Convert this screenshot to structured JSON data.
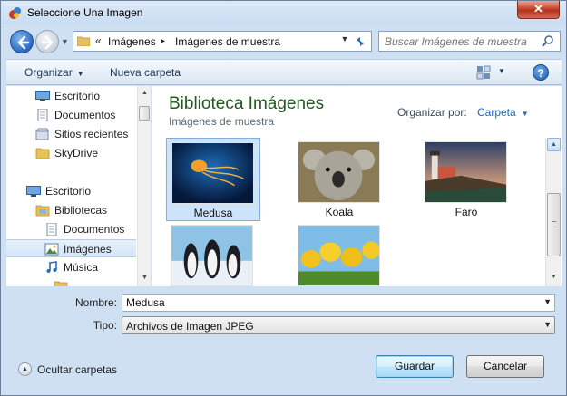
{
  "window": {
    "title": "Seleccione Una Imagen",
    "close_label": "✕"
  },
  "address": {
    "breadcrumb_prefix": "«",
    "crumbs": [
      "Imágenes",
      "Imágenes de muestra"
    ],
    "separator": "▸"
  },
  "search": {
    "placeholder": "Buscar Imágenes de muestra"
  },
  "toolbar": {
    "organize_label": "Organizar",
    "new_folder_label": "Nueva carpeta",
    "help_label": "?"
  },
  "navpane": {
    "items": [
      {
        "label": "Escritorio",
        "icon": "desktop-icon"
      },
      {
        "label": "Documentos",
        "icon": "documents-icon"
      },
      {
        "label": "Sitios recientes",
        "icon": "recent-places-icon"
      },
      {
        "label": "SkyDrive",
        "icon": "folder-icon"
      },
      {
        "label": "Escritorio",
        "icon": "desktop-icon"
      },
      {
        "label": "Bibliotecas",
        "icon": "libraries-icon"
      },
      {
        "label": "Documentos",
        "icon": "documents-icon"
      },
      {
        "label": "Imágenes",
        "icon": "pictures-icon",
        "selected": true
      },
      {
        "label": "Música",
        "icon": "music-icon"
      }
    ]
  },
  "content": {
    "library_title": "Biblioteca Imágenes",
    "library_subtitle": "Imágenes de muestra",
    "arrange_label": "Organizar por:",
    "arrange_value": "Carpeta",
    "thumbnails": [
      {
        "label": "Medusa",
        "subject": "jellyfish",
        "selected": true
      },
      {
        "label": "Koala",
        "subject": "koala"
      },
      {
        "label": "Faro",
        "subject": "lighthouse"
      },
      {
        "label": "",
        "subject": "penguins"
      },
      {
        "label": "",
        "subject": "tulips"
      }
    ]
  },
  "form": {
    "name_label": "Nombre:",
    "name_value": "Medusa",
    "type_label": "Tipo:",
    "type_value": "Archivos de Imagen JPEG"
  },
  "footer": {
    "hide_folders_label": "Ocultar carpetas",
    "save_label": "Guardar",
    "cancel_label": "Cancelar"
  }
}
